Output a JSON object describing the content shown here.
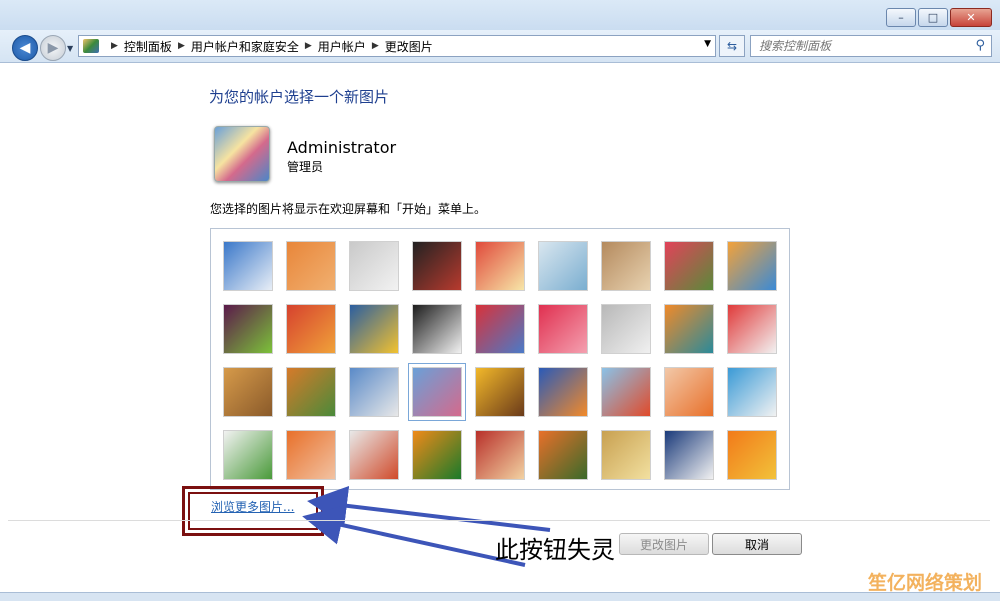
{
  "window": {
    "minimize": "–",
    "maximize": "□",
    "close": "✕"
  },
  "nav": {
    "back_icon": "back-arrow-icon",
    "forward_icon": "forward-arrow-icon",
    "breadcrumbs": [
      "控制面板",
      "用户帐户和家庭安全",
      "用户帐户",
      "更改图片"
    ],
    "search_placeholder": "搜索控制面板"
  },
  "page": {
    "heading": "为您的帐户选择一个新图片",
    "user_name": "Administrator",
    "user_role": "管理员",
    "note": "您选择的图片将显示在欢迎屏幕和「开始」菜单上。",
    "browse_link": "浏览更多图片...",
    "change_button": "更改图片",
    "cancel_button": "取消",
    "annotation_caption": "此按钮失灵",
    "watermark": "笙亿网络策划"
  },
  "pictures": [
    {
      "name": "roller-coaster",
      "colors": [
        "#3b78c9",
        "#e8eef6"
      ]
    },
    {
      "name": "starfish",
      "colors": [
        "#e8863a",
        "#f1b070"
      ]
    },
    {
      "name": "robot-toy",
      "colors": [
        "#c9c9c9",
        "#f2f2f2"
      ]
    },
    {
      "name": "vinyl-record",
      "colors": [
        "#222222",
        "#b83a2e"
      ]
    },
    {
      "name": "lucky-cat",
      "colors": [
        "#e04a3b",
        "#f7e6a8"
      ]
    },
    {
      "name": "spinning-top",
      "colors": [
        "#d9e6ef",
        "#7aaed0"
      ]
    },
    {
      "name": "kitten",
      "colors": [
        "#b48a5e",
        "#e8d2b0"
      ]
    },
    {
      "name": "flower-pink",
      "colors": [
        "#e2425a",
        "#5a8a3a"
      ]
    },
    {
      "name": "pinwheel",
      "colors": [
        "#f3a23a",
        "#3a8ad6"
      ]
    },
    {
      "name": "ball",
      "colors": [
        "#5b1a4b",
        "#7cc23a"
      ]
    },
    {
      "name": "fabric",
      "colors": [
        "#d6422e",
        "#f0a23a"
      ]
    },
    {
      "name": "leaf",
      "colors": [
        "#2b5ea0",
        "#f2c230"
      ]
    },
    {
      "name": "dog-border-collie",
      "colors": [
        "#1c1c1c",
        "#f2f2f2"
      ]
    },
    {
      "name": "crayons",
      "colors": [
        "#d8323a",
        "#4a7ac8"
      ]
    },
    {
      "name": "paper-star",
      "colors": [
        "#e03050",
        "#f4a0b0"
      ]
    },
    {
      "name": "jacks",
      "colors": [
        "#b8b8b8",
        "#f0f0f0"
      ]
    },
    {
      "name": "stairs",
      "colors": [
        "#f08a2a",
        "#2a8a9a"
      ]
    },
    {
      "name": "origami-crane",
      "colors": [
        "#e03a3a",
        "#f2f2f2"
      ]
    },
    {
      "name": "guitar",
      "colors": [
        "#d69a4a",
        "#8a5a2a"
      ]
    },
    {
      "name": "pomeranian",
      "colors": [
        "#d67a2a",
        "#4a8a3a"
      ]
    },
    {
      "name": "toy-robot",
      "colors": [
        "#5a8ac8",
        "#e8e8e8"
      ]
    },
    {
      "name": "ribbons",
      "colors": [
        "#6aa0d8",
        "#d46a8c"
      ]
    },
    {
      "name": "sunflower",
      "colors": [
        "#f2b82a",
        "#6a3a1a"
      ]
    },
    {
      "name": "fish",
      "colors": [
        "#2a5ab8",
        "#f28a2a"
      ]
    },
    {
      "name": "hot-air-balloon",
      "colors": [
        "#8ac2e8",
        "#e04a2a"
      ]
    },
    {
      "name": "doll",
      "colors": [
        "#f2c8a8",
        "#e8702a"
      ]
    },
    {
      "name": "sailboat",
      "colors": [
        "#3a9ad6",
        "#f2f2f2"
      ]
    },
    {
      "name": "soccer-ball",
      "colors": [
        "#f2f2f2",
        "#4a9a3a"
      ]
    },
    {
      "name": "textile",
      "colors": [
        "#e8702a",
        "#f2c2a2"
      ]
    },
    {
      "name": "marbles",
      "colors": [
        "#e8e8e8",
        "#d04a2a"
      ]
    },
    {
      "name": "window-green",
      "colors": [
        "#f08a1a",
        "#1a7a2a"
      ]
    },
    {
      "name": "pattern-red",
      "colors": [
        "#b8302a",
        "#f2d2a2"
      ]
    },
    {
      "name": "butterfly",
      "colors": [
        "#e8702a",
        "#3a6a2a"
      ]
    },
    {
      "name": "spiral-shell",
      "colors": [
        "#c8a050",
        "#f2e0a0"
      ]
    },
    {
      "name": "lighthouse",
      "colors": [
        "#1a3a7a",
        "#f2f2f2"
      ]
    },
    {
      "name": "gerbera",
      "colors": [
        "#f27a1a",
        "#f2c23a"
      ]
    }
  ],
  "selected_picture": "ribbons"
}
